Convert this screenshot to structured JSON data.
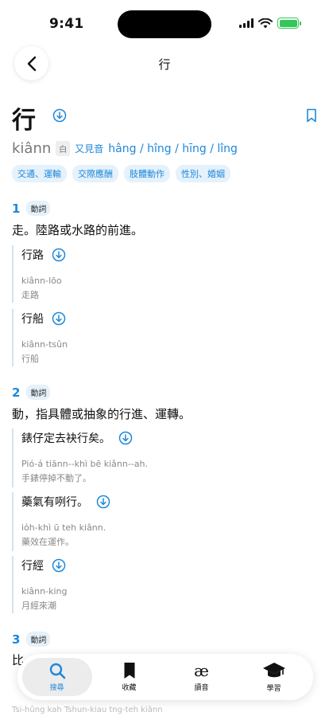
{
  "status": {
    "time": "9:41"
  },
  "nav": {
    "title": "行"
  },
  "entry": {
    "headword": "行",
    "pronunciation": "kiânn",
    "reading_tag": "白",
    "alt_label": "又見音",
    "alt_readings": "hâng / hîng / hīng / lîng",
    "categories": [
      "交通、運輸",
      "交際應酬",
      "肢體動作",
      "性別、婚姻"
    ]
  },
  "senses": [
    {
      "num": "1",
      "pos": "動詞",
      "definition": "走。陸路或水路的前進。",
      "examples": [
        {
          "text": "行路",
          "romanization": "kiânn-lōo",
          "translation": "走路"
        },
        {
          "text": "行船",
          "romanization": "kiânn-tsûn",
          "translation": "行船"
        }
      ]
    },
    {
      "num": "2",
      "pos": "動詞",
      "definition": "動，指具體或抽象的行進、運轉。",
      "examples": [
        {
          "text": "錶仔定去袂行矣。",
          "romanization": "Pió-á tiānn--khì bē kiânn--ah.",
          "translation": "手錶停掉不動了。"
        },
        {
          "text": "藥氣有咧行。",
          "romanization": "io̍h-khì ū teh kiânn.",
          "translation": "藥效在運作。"
        },
        {
          "text": "行經",
          "romanization": "kiânn-king",
          "translation": "月經來潮"
        }
      ]
    },
    {
      "num": "3",
      "pos": "動詞",
      "definition": "比",
      "peek_romanization": "Tsi-hûng kah Tshun-kiau tng-teh kiânn"
    }
  ],
  "tabbar": {
    "tabs": [
      {
        "label": "搜尋",
        "icon": "search-icon",
        "active": true
      },
      {
        "label": "收藏",
        "icon": "bookmark-icon",
        "active": false
      },
      {
        "label": "讀音",
        "icon": "ae-icon",
        "glyph": "æ",
        "active": false
      },
      {
        "label": "學習",
        "icon": "graduation-cap-icon",
        "active": false
      }
    ]
  },
  "colors": {
    "accent": "#1e88d9",
    "chip_bg": "#e5f1fb",
    "battery": "#34c759"
  }
}
